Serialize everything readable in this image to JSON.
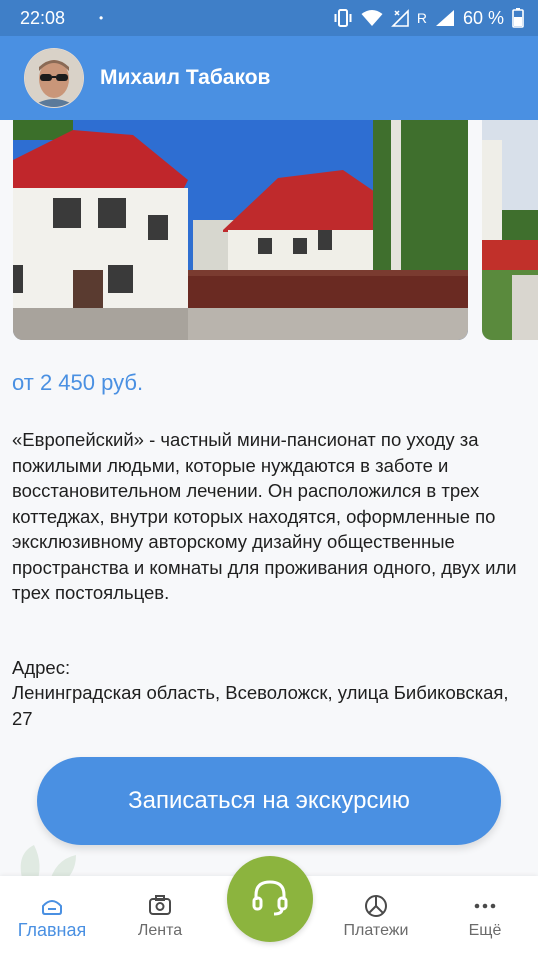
{
  "status_bar": {
    "time": "22:08",
    "dot": "•",
    "roaming": "R",
    "battery": "60 %"
  },
  "header": {
    "name": "Михаил Табаков"
  },
  "listing": {
    "price": "от 2 450 руб.",
    "description": "«Европейский» - частный мини-пансионат по уходу за пожилыми людьми, которые нуждаются в заботе и восстановительном лечении. Он расположился в трех коттеджах, внутри которых находятся, оформленные по эксклюзивному авторскому дизайну общественные пространства и комнаты для проживания одного, двух или трех постояльцев.",
    "address_label": "Адрес:",
    "address": "Ленинградская область, Всеволожск, улица Бибиковская, 27",
    "cta": "Записаться на экскурсию"
  },
  "nav": {
    "items": [
      {
        "label": "Главная",
        "icon": "home-icon",
        "active": true
      },
      {
        "label": "Лента",
        "icon": "feed-icon",
        "active": false
      },
      {
        "label": "Платежи",
        "icon": "payments-icon",
        "active": false
      },
      {
        "label": "Ещё",
        "icon": "more-icon",
        "active": false
      }
    ],
    "center_icon": "headset-icon"
  },
  "colors": {
    "primary": "#4a90e2",
    "status_bar": "#3f7fc8",
    "center_button": "#8cb43e"
  }
}
